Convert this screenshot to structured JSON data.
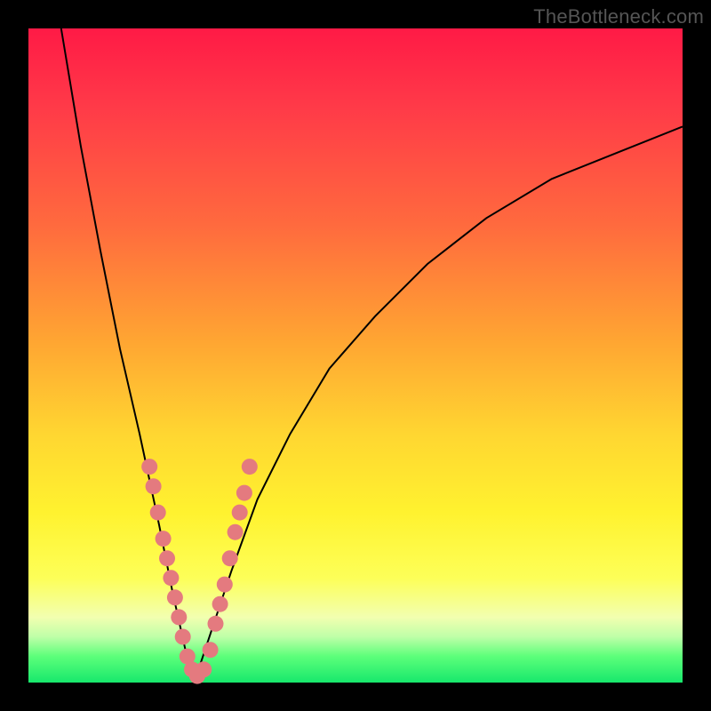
{
  "watermark": "TheBottleneck.com",
  "colors": {
    "frame": "#000000",
    "marker": "#e47a7f",
    "gradient_stops": [
      "#ff1a46",
      "#ff6a3e",
      "#ffd631",
      "#fff22f",
      "#17e86c"
    ]
  },
  "chart_data": {
    "type": "line",
    "title": "",
    "xlabel": "",
    "ylabel": "",
    "xlim": [
      0,
      100
    ],
    "ylim": [
      0,
      100
    ],
    "grid": false,
    "legend": false,
    "curve": {
      "description": "V-shaped bottleneck curve; goes from 100 at x≈5 down to ≈0 at the vertex near x≈25, then rises with diminishing slope toward ≈85 at x=100",
      "x": [
        5,
        8,
        11,
        14,
        17,
        20,
        22,
        24,
        25,
        26,
        28,
        31,
        35,
        40,
        46,
        53,
        61,
        70,
        80,
        90,
        100
      ],
      "y": [
        100,
        82,
        66,
        51,
        38,
        24,
        14,
        5,
        1,
        2,
        8,
        17,
        28,
        38,
        48,
        56,
        64,
        71,
        77,
        81,
        85
      ]
    },
    "markers": {
      "description": "salmon circular markers clustered along both arms of the V near the vertex",
      "points": [
        {
          "x": 18.5,
          "y": 33
        },
        {
          "x": 19.1,
          "y": 30
        },
        {
          "x": 19.8,
          "y": 26
        },
        {
          "x": 20.6,
          "y": 22
        },
        {
          "x": 21.2,
          "y": 19
        },
        {
          "x": 21.8,
          "y": 16
        },
        {
          "x": 22.4,
          "y": 13
        },
        {
          "x": 23.0,
          "y": 10
        },
        {
          "x": 23.6,
          "y": 7
        },
        {
          "x": 24.3,
          "y": 4
        },
        {
          "x": 25.0,
          "y": 2
        },
        {
          "x": 25.8,
          "y": 1
        },
        {
          "x": 26.8,
          "y": 2
        },
        {
          "x": 27.8,
          "y": 5
        },
        {
          "x": 28.6,
          "y": 9
        },
        {
          "x": 29.3,
          "y": 12
        },
        {
          "x": 30.0,
          "y": 15
        },
        {
          "x": 30.8,
          "y": 19
        },
        {
          "x": 31.6,
          "y": 23
        },
        {
          "x": 32.3,
          "y": 26
        },
        {
          "x": 33.0,
          "y": 29
        },
        {
          "x": 33.8,
          "y": 33
        }
      ],
      "radius": 9
    }
  }
}
